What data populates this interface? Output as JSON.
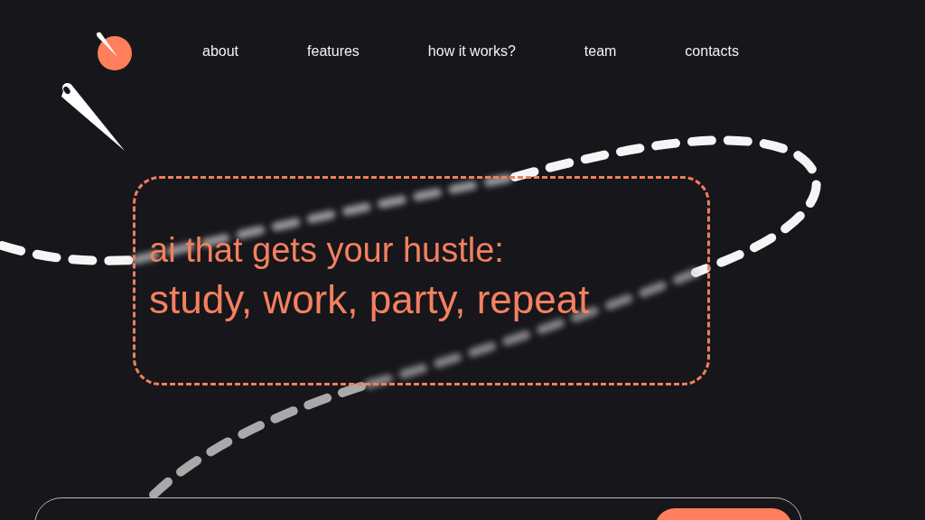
{
  "nav": {
    "links": [
      "about",
      "features",
      "how it works?",
      "team",
      "contacts"
    ]
  },
  "hero": {
    "title_lines": [
      "ai that gets your hustle:",
      "study, work, party, repeat"
    ]
  }
}
